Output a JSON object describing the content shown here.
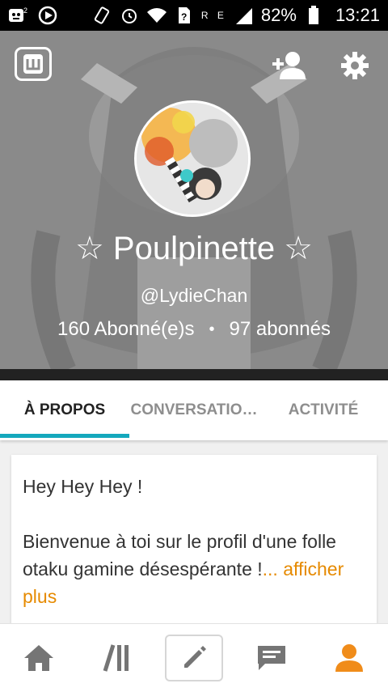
{
  "statusbar": {
    "battery": "82%",
    "time": "13:21",
    "network_letters": "R E"
  },
  "profile": {
    "name": "☆ Poulpinette ☆",
    "handle": "@LydieChan",
    "following": "160 Abonné(e)s",
    "separator": "•",
    "followers": "97 abonnés"
  },
  "tabs": [
    {
      "label": "À PROPOS"
    },
    {
      "label": "CONVERSATIO…"
    },
    {
      "label": "ACTIVITÉ"
    }
  ],
  "about": {
    "line1": "Hey Hey Hey !",
    "line2": "Bienvenue à toi sur le profil d'une folle otaku gamine désespérante !",
    "ellipsis": "...",
    "more_label": "afficher plus"
  },
  "colors": {
    "accent": "#14a8bd",
    "link": "#e68a00",
    "profile_nav": "#f08c1a",
    "nav_gray": "#757575"
  },
  "icons": {
    "logo": "app-logo-icon",
    "add_user": "add-user-icon",
    "settings": "gear-icon",
    "home": "home-icon",
    "catalog": "catalog-icon",
    "compose": "pencil-icon",
    "chat": "chat-icon",
    "profile": "profile-icon"
  }
}
